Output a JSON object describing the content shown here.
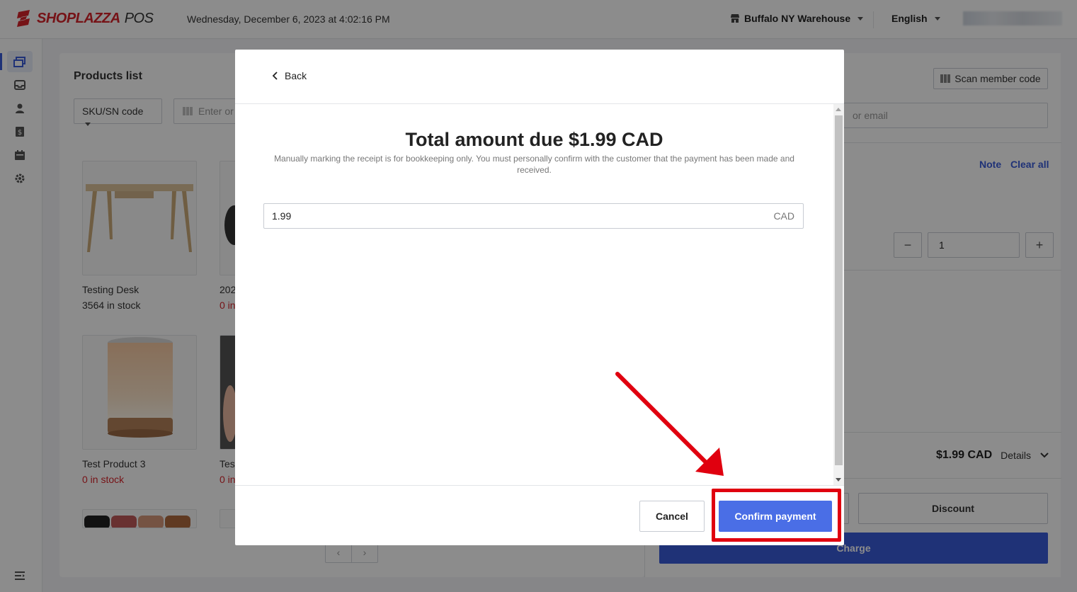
{
  "header": {
    "brand_name": "SHOPLAZZA",
    "brand_suffix": "POS",
    "datetime": "Wednesday, December 6, 2023 at 4:02:16 PM",
    "location": "Buffalo NY Warehouse",
    "language": "English"
  },
  "colors": {
    "brand_red": "#d8242b",
    "accent_blue": "#3a5bd9",
    "confirm_blue": "#4a6ee6",
    "annotation_red": "#e0000f"
  },
  "sidebar": {
    "items": [
      {
        "icon": "register-icon",
        "active": true
      },
      {
        "icon": "inbox-icon",
        "active": false
      },
      {
        "icon": "customer-icon",
        "active": false
      },
      {
        "icon": "dollar-icon",
        "active": false
      },
      {
        "icon": "calendar-icon",
        "active": false
      },
      {
        "icon": "gear-icon",
        "active": false
      }
    ],
    "bottom_icon": "menu-expand-icon"
  },
  "products": {
    "title": "Products list",
    "filter_select": "SKU/SN code",
    "search_placeholder": "Enter or",
    "items": [
      {
        "name": "Testing Desk",
        "stock": "3564 in stock"
      },
      {
        "name": "202",
        "stock": "0 in"
      },
      {
        "name": "Test Product 3",
        "stock": "0 in stock"
      },
      {
        "name": "Test",
        "stock": "0 in"
      }
    ]
  },
  "cart": {
    "scan_member_label": "Scan member code",
    "member_search_placeholder": "or email",
    "note_label": "Note",
    "clear_all_label": "Clear all",
    "quantity": "1",
    "total": "$1.99 CAD",
    "details_label": "Details",
    "discount_label": "Discount",
    "charge_label": "Charge"
  },
  "modal": {
    "back_label": "Back",
    "title": "Total amount due $1.99 CAD",
    "note": "Manually marking the receipt is for bookkeeping only. You must personally confirm with the customer that the payment has been made and received.",
    "amount_value": "1.99",
    "currency": "CAD",
    "cancel_label": "Cancel",
    "confirm_label": "Confirm payment"
  }
}
